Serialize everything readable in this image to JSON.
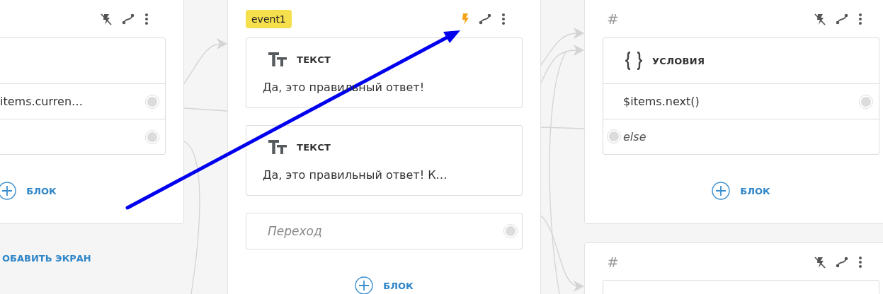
{
  "screens": [
    {
      "trigger_active": false,
      "blocks": [
        {
          "kind": "conditions",
          "rows": [
            {
              "kind": "condition",
              "text": "items.curren…"
            },
            {
              "kind": "condition"
            }
          ]
        }
      ],
      "add_block": "БЛОК"
    },
    {
      "tag": {
        "kind": "event",
        "text": "event1"
      },
      "trigger_active": true,
      "blocks": [
        {
          "kind": "text",
          "title": "ТЕКСТ",
          "body": "Да, это правильный ответ!"
        },
        {
          "kind": "text",
          "title": "ТЕКСТ",
          "body": "Да, это правильный ответ! К…"
        },
        {
          "kind": "transition",
          "placeholder": "Переход"
        }
      ],
      "add_block": "БЛОК"
    },
    {
      "tag": {
        "kind": "id",
        "text": "#"
      },
      "trigger_active": false,
      "blocks": [
        {
          "kind": "conditions",
          "title": "УСЛОВИЯ",
          "rows": [
            {
              "kind": "condition",
              "text": "$items.next()"
            },
            {
              "kind": "else",
              "text": "else"
            }
          ]
        }
      ],
      "add_block": "БЛОК"
    },
    {
      "tag": {
        "kind": "id",
        "text": "#"
      },
      "trigger_active": false,
      "blocks": [
        {
          "kind": "conditions"
        }
      ]
    }
  ],
  "add_screen": "ОБАВИТЬ ЭКРАН"
}
